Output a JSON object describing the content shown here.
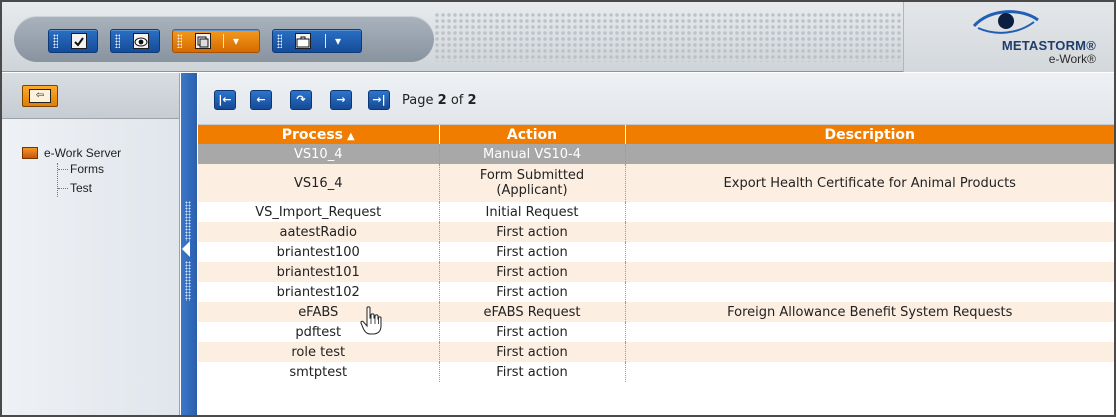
{
  "toolbar": {
    "buttons": [
      {
        "icon": "checkbox-icon",
        "color": "blue"
      },
      {
        "icon": "eye-icon",
        "color": "blue"
      },
      {
        "icon": "folder-stack-icon",
        "color": "orange",
        "has_dropdown": true
      },
      {
        "icon": "briefcase-icon",
        "color": "blue",
        "has_dropdown": true
      }
    ]
  },
  "logo": {
    "name": "METASTORM®",
    "sub": "e-Work®"
  },
  "left": {
    "back_icon": "exit-icon",
    "tree": {
      "root": "e-Work Server",
      "children": [
        "Forms",
        "Test"
      ]
    }
  },
  "pager": {
    "buttons": [
      "first-page-icon",
      "previous-page-icon",
      "refresh-icon",
      "next-page-icon",
      "last-page-icon"
    ],
    "prefix": "Page",
    "current": "2",
    "of_text": "of",
    "total": "2"
  },
  "table": {
    "columns": {
      "process": "Process",
      "action": "Action",
      "description": "Description"
    },
    "sort_indicator": "▲",
    "rows": [
      {
        "process": "VS10_4",
        "action": "Manual VS10-4",
        "description": ""
      },
      {
        "process": "VS16_4",
        "action": "Form Submitted (Applicant)",
        "description": "Export Health Certificate for Animal Products"
      },
      {
        "process": "VS_Import_Request",
        "action": "Initial Request",
        "description": ""
      },
      {
        "process": "aatestRadio",
        "action": "First action",
        "description": ""
      },
      {
        "process": "briantest100",
        "action": "First action",
        "description": ""
      },
      {
        "process": "briantest101",
        "action": "First action",
        "description": ""
      },
      {
        "process": "briantest102",
        "action": "First action",
        "description": ""
      },
      {
        "process": "eFABS",
        "action": "eFABS Request",
        "description": "Foreign Allowance Benefit System Requests"
      },
      {
        "process": "pdftest",
        "action": "First action",
        "description": ""
      },
      {
        "process": "role test",
        "action": "First action",
        "description": ""
      },
      {
        "process": "smtptest",
        "action": "First action",
        "description": ""
      }
    ]
  },
  "colors": {
    "accent_orange": "#f07c00",
    "nav_blue": "#1f5fb4",
    "selected_row": "#a8a8a8",
    "alt_row": "#fdeee2"
  }
}
